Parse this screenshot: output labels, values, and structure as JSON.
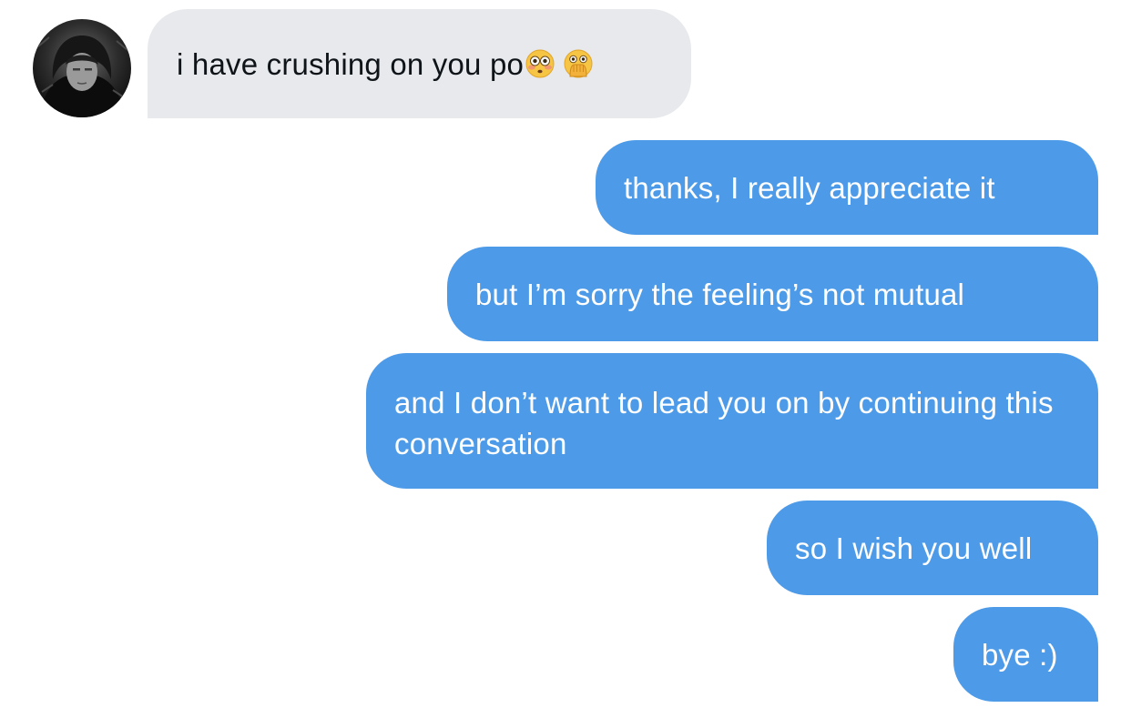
{
  "conversation": {
    "incoming": [
      {
        "text": "i have crushing on you po",
        "emojis": [
          "flushed-face-emoji",
          "face-with-open-eyes-and-hand-over-mouth-emoji"
        ]
      }
    ],
    "outgoing": [
      {
        "text": "thanks, I really appreciate it"
      },
      {
        "text": "but I’m sorry the feeling’s not mutual"
      },
      {
        "text": "and I don’t want to lead you on by continuing this conversation"
      },
      {
        "text": "so I wish you well"
      },
      {
        "text": "bye :)"
      }
    ]
  },
  "colors": {
    "incoming_bubble": "#e7e9ed",
    "outgoing_bubble": "#4d9be8",
    "incoming_text": "#0f1419",
    "outgoing_text": "#ffffff",
    "background": "#ffffff"
  }
}
